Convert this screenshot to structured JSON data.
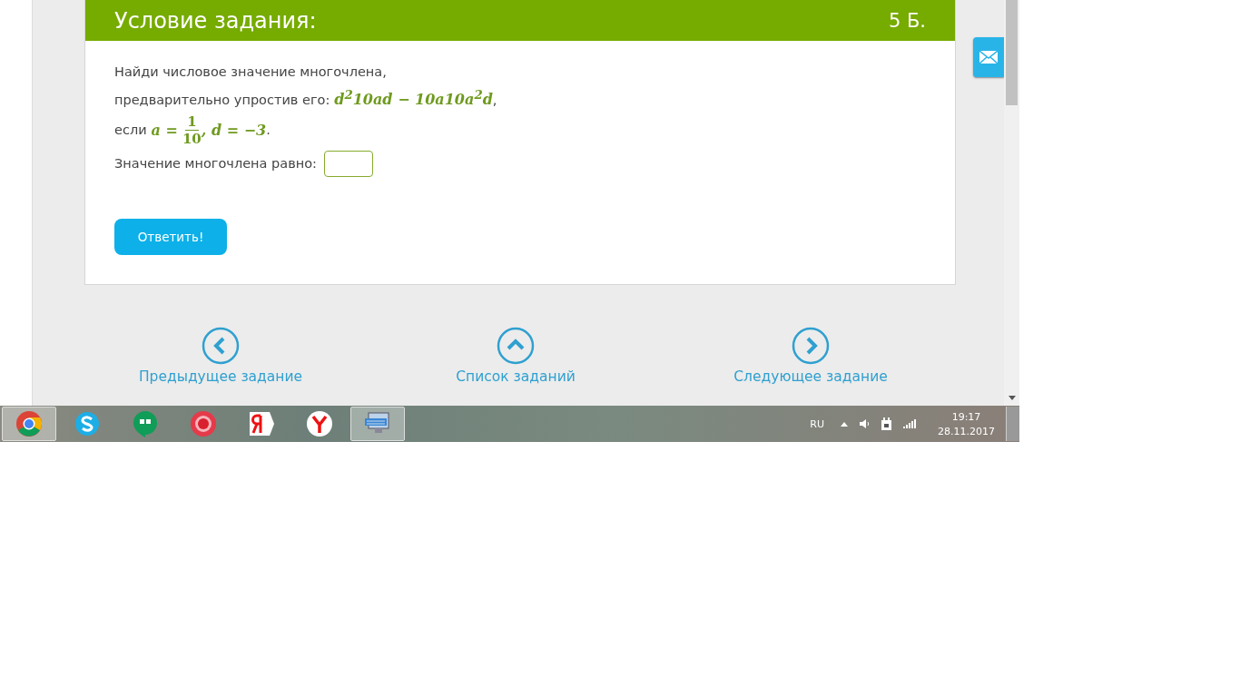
{
  "task": {
    "title": "Условие задания:",
    "points": "5 Б.",
    "line1": "Найди числовое значение многочлена,",
    "line2": {
      "text": "предварительно упростив его:",
      "expr": "d$^{2}$10ad − 10a10a$^{2}$d",
      "tail": ","
    },
    "line3": {
      "text": "если",
      "lhs": "a =",
      "numerator": "1",
      "denominator": "10",
      "rhs": ", d = −3",
      "tail": "."
    },
    "answer_label": "Значение многочлена равно:",
    "submit": "Ответить!"
  },
  "nav": [
    {
      "kind": "prev",
      "label": "Предыдущее задание"
    },
    {
      "kind": "list",
      "label": "Список заданий"
    },
    {
      "kind": "next",
      "label": "Следующее задание"
    }
  ],
  "taskbar": {
    "apps": [
      {
        "kind": "chrome",
        "selected": true
      },
      {
        "kind": "skype",
        "selected": false
      },
      {
        "kind": "hangouts",
        "selected": false
      },
      {
        "kind": "record",
        "selected": false
      },
      {
        "kind": "yandex",
        "selected": false
      },
      {
        "kind": "ybrowser",
        "selected": false
      },
      {
        "kind": "keyboard",
        "selected": true
      }
    ],
    "language": "RU",
    "time": "19:17",
    "date": "28.11.2017"
  }
}
